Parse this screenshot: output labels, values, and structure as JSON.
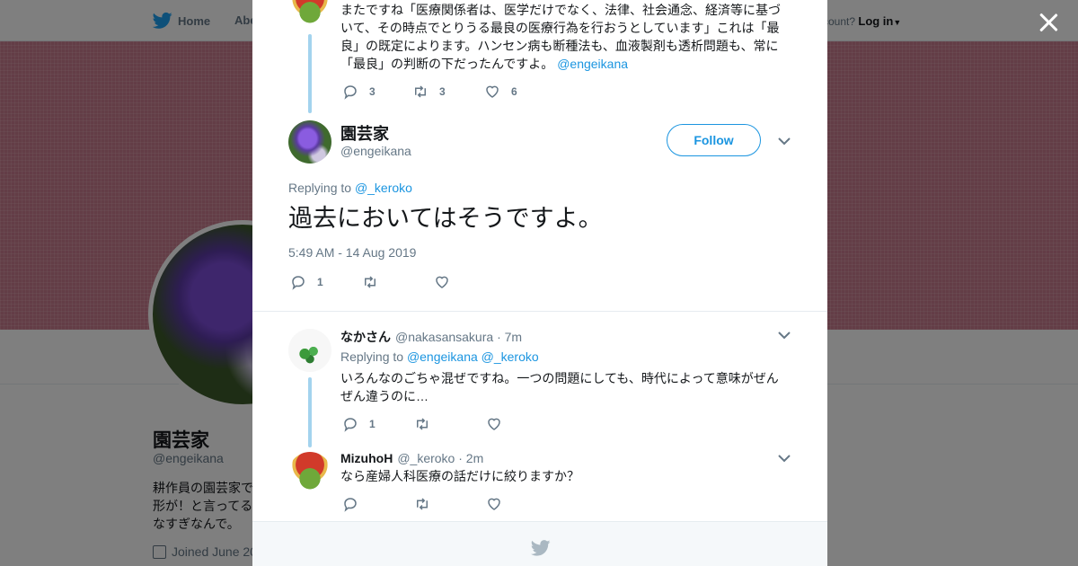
{
  "nav": {
    "home_label": "Home",
    "about_label": "Abe",
    "account_prompt": "ccount?",
    "login_label": "Log in"
  },
  "background_profile": {
    "name": "園芸家",
    "handle": "@engeikana",
    "bio": "耕作員の園芸家で形が！と言ってるなすぎなんで。",
    "joined": "Joined June 20"
  },
  "thread": {
    "prev_tweet": {
      "text": "またですね「医療関係者は、医学だけでなく、法律、社会通念、経済等に基づいて、その時点でとりうる最良の医療行為を行おうとしています」これは「最良」の既定によります。ハンセン病も断種法も、血液製剤も透析問題も、常に「最良」の判断の下だったんですよ。",
      "mention": "@engeikana",
      "reply_count": "3",
      "retweet_count": "3",
      "like_count": "6"
    },
    "main_tweet": {
      "name": "園芸家",
      "handle": "@engeikana",
      "follow_label": "Follow",
      "replying_prefix": "Replying to",
      "replying_handle": "@_keroko",
      "text": "過去においてはそうですよ。",
      "timestamp": "5:49 AM - 14 Aug 2019",
      "reply_count": "1",
      "retweet_count": "",
      "like_count": ""
    },
    "replies": [
      {
        "name": "なかさん",
        "handle": "@nakasansakura",
        "time": "· 7m",
        "replying_prefix": "Replying to",
        "replying_handles": "@engeikana @_keroko",
        "text": "いろんなのごちゃ混ぜですね。一つの問題にしても、時代によって意味がぜんぜん違うのに…",
        "reply_count": "1",
        "retweet_count": "",
        "like_count": ""
      },
      {
        "name": "MizuhoH",
        "handle": "@_keroko",
        "time": "· 2m",
        "text": "なら産婦人科医療の話だけに絞りますか？",
        "reply_count": "",
        "retweet_count": "",
        "like_count": ""
      }
    ]
  },
  "colors": {
    "accent": "#1b95e0",
    "thread_line": "#a3d3ee",
    "banner": "#c77b8d",
    "muted_text": "#657786"
  },
  "icons": [
    "twitter-bird-icon",
    "close-icon",
    "reply-icon",
    "retweet-icon",
    "like-icon",
    "chevron-down-icon",
    "calendar-icon"
  ]
}
